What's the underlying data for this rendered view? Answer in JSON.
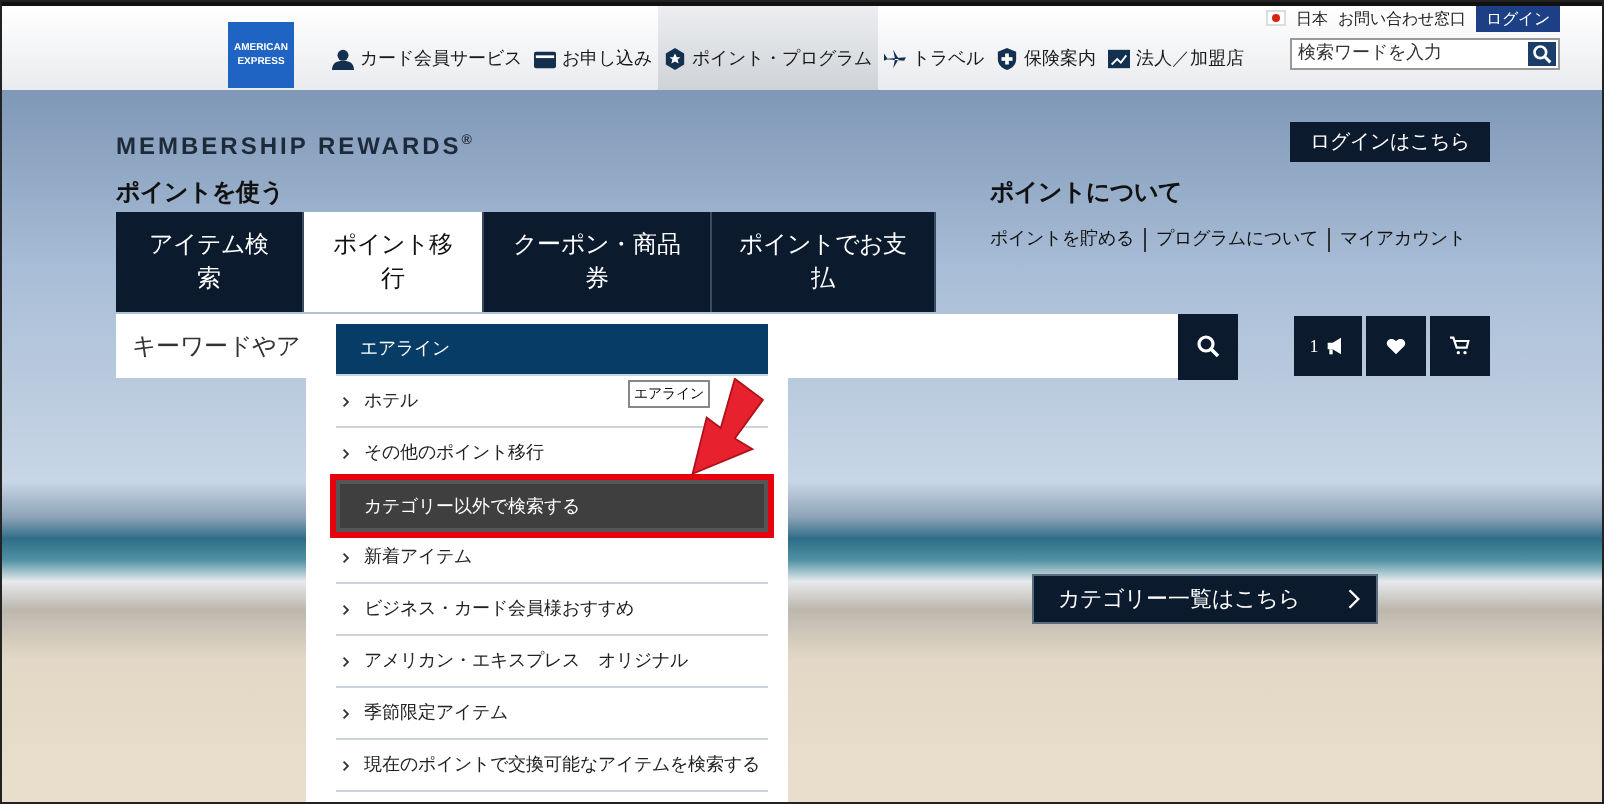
{
  "header": {
    "logo": [
      "AMERICAN",
      "EXPRESS"
    ],
    "utility": [
      {
        "label": "日本",
        "kind": "flag"
      },
      {
        "label": "お問い合わせ窓口",
        "kind": "link"
      }
    ],
    "login": "ログイン",
    "nav": [
      {
        "label": "カード会員サービス",
        "kind": "member",
        "selected": false
      },
      {
        "label": "お申し込み",
        "kind": "card",
        "selected": false
      },
      {
        "label": "ポイント・プログラム",
        "kind": "points",
        "selected": true
      },
      {
        "label": "トラベル",
        "kind": "travel",
        "selected": false
      },
      {
        "label": "保険案内",
        "kind": "insurance",
        "selected": false
      },
      {
        "label": "法人／加盟店",
        "kind": "business",
        "selected": false
      }
    ],
    "search": {
      "placeholder": "検索ワードを入力"
    }
  },
  "rewards": {
    "brand": "MEMBERSHIP REWARDS$^{®}$",
    "login_button": "ログインはこちら",
    "use_heading": "ポイントを使う",
    "tabs": [
      {
        "label": "アイテム検索",
        "selected": false
      },
      {
        "label": "ポイント移行",
        "selected": true
      },
      {
        "label": "クーポン・商品券",
        "selected": false
      },
      {
        "label": "ポイントでお支払",
        "selected": false
      }
    ],
    "about_heading": "ポイントについて",
    "about_links": [
      "ポイントを貯める",
      "プログラムについて",
      "マイアカウント"
    ],
    "search": {
      "placeholder": "キーワードやア"
    },
    "tools": [
      {
        "kind": "news",
        "count": "1"
      },
      {
        "kind": "favorite"
      },
      {
        "kind": "cart"
      }
    ],
    "dropdown": [
      {
        "label": "エアライン",
        "kind": "header",
        "highlighted": false
      },
      {
        "label": "ホテル",
        "kind": "item",
        "highlighted": false
      },
      {
        "label": "その他のポイント移行",
        "kind": "item",
        "highlighted": false
      },
      {
        "label": "カテゴリー以外で検索する",
        "kind": "action",
        "highlighted": true
      },
      {
        "label": "新着アイテム",
        "kind": "item",
        "highlighted": false
      },
      {
        "label": "ビジネス・カード会員様おすすめ",
        "kind": "item",
        "highlighted": false
      },
      {
        "label": "アメリカン・エキスプレス　オリジナル",
        "kind": "item",
        "highlighted": false
      },
      {
        "label": "季節限定アイテム",
        "kind": "item",
        "highlighted": false
      },
      {
        "label": "現在のポイントで交換可能なアイテムを検索する",
        "kind": "item",
        "highlighted": false
      }
    ],
    "tooltip": "エアライン",
    "category_button": "カテゴリー一覧はこちら"
  }
}
